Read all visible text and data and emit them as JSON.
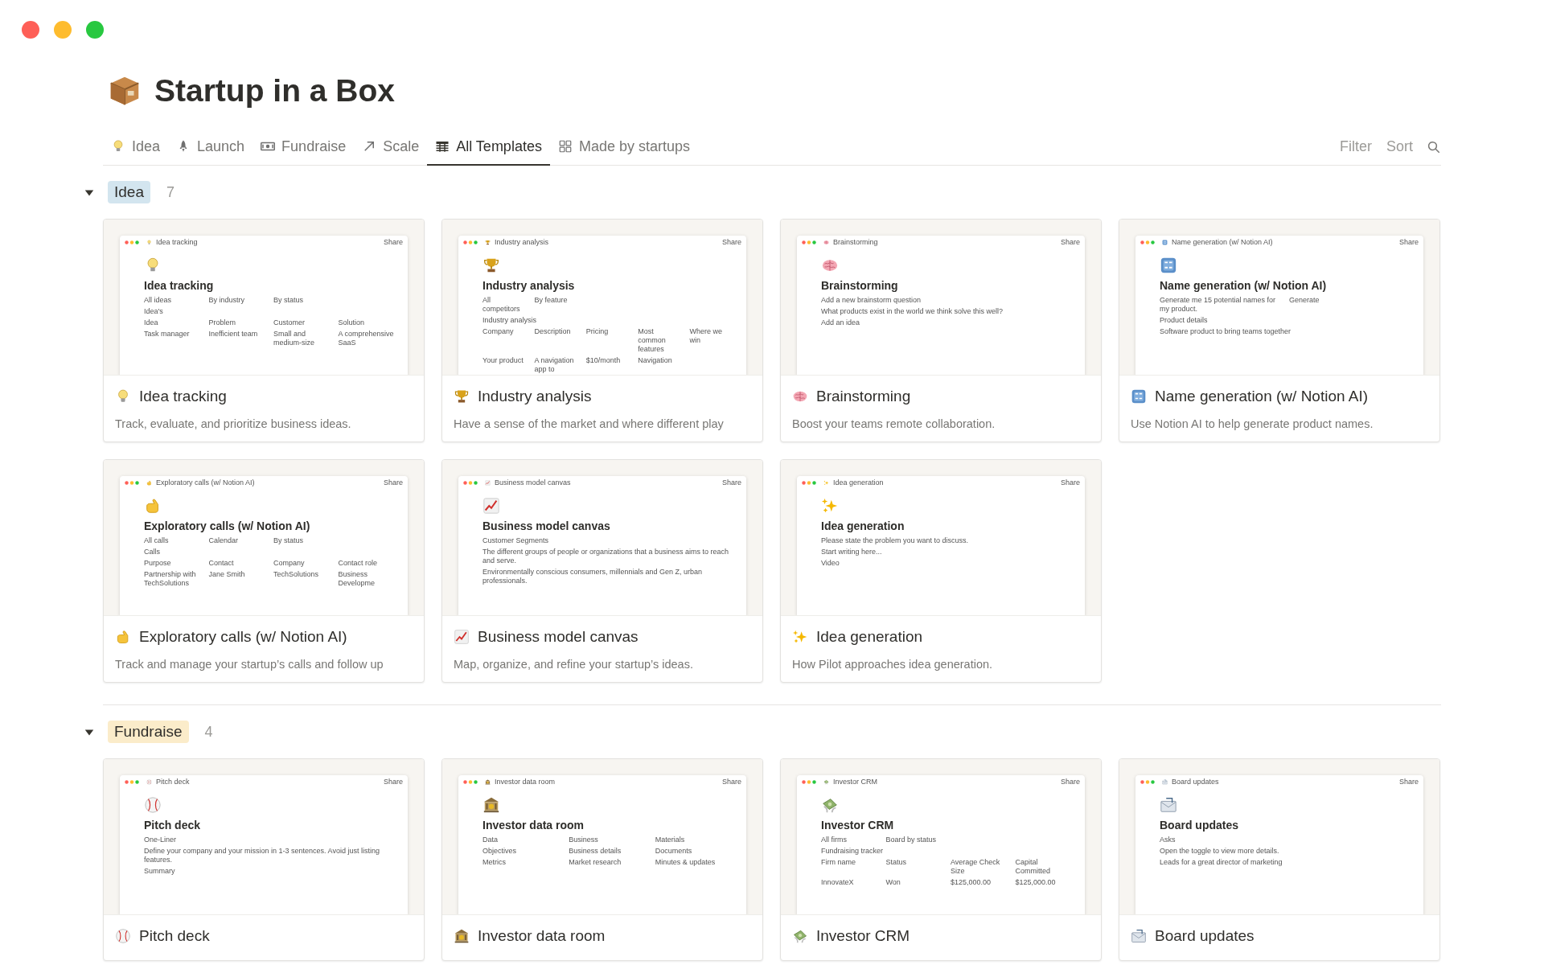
{
  "page": {
    "title": "Startup in a Box"
  },
  "tabs": [
    {
      "label": "Idea",
      "selected": false
    },
    {
      "label": "Launch",
      "selected": false
    },
    {
      "label": "Fundraise",
      "selected": false
    },
    {
      "label": "Scale",
      "selected": false
    },
    {
      "label": "All Templates",
      "selected": true
    },
    {
      "label": "Made by startups",
      "selected": false
    }
  ],
  "view_actions": [
    "Filter",
    "Sort"
  ],
  "groups": [
    {
      "label": "Idea",
      "count": "7",
      "color": "#d3e5ef",
      "expanded": true,
      "cards": [
        {
          "title": "Idea tracking",
          "description": "Track, evaluate, and prioritize business ideas.",
          "preview": {
            "crumb": "Idea tracking",
            "share": "Share",
            "title": "Idea tracking",
            "rows": [
              [
                "All ideas",
                "By industry",
                "By status"
              ],
              [
                "Idea's"
              ],
              [
                "Idea",
                "Problem",
                "Customer",
                "Solution"
              ],
              [
                "Task manager",
                "Inefficient team",
                "Small and medium-size",
                "A comprehensive SaaS"
              ]
            ]
          }
        },
        {
          "title": "Industry analysis",
          "description": "Have a sense of the market and where different play",
          "preview": {
            "crumb": "Industry analysis",
            "share": "Share",
            "title": "Industry analysis",
            "rows": [
              [
                "All competitors",
                "By feature"
              ],
              [
                "Industry analysis"
              ],
              [
                "Company",
                "Description",
                "Pricing",
                "Most common features",
                "Where we win"
              ],
              [
                "Your product",
                "A navigation app to",
                "$10/month",
                "Navigation"
              ]
            ]
          }
        },
        {
          "title": "Brainstorming",
          "description": "Boost your teams remote collaboration.",
          "preview": {
            "crumb": "Brainstorming",
            "share": "Share",
            "title": "Brainstorming",
            "rows": [
              [
                "Add a new brainstorm question"
              ],
              [
                "What products exist in the world we think solve this well?"
              ],
              [
                "Add an idea"
              ]
            ]
          }
        },
        {
          "title": "Name generation (w/ Notion AI)",
          "description": "Use Notion AI to help generate product names.",
          "preview": {
            "crumb": "Name generation (w/ Notion AI)",
            "share": "Share",
            "title": "Name generation (w/ Notion AI)",
            "rows": [
              [
                "Generate me 15 potential names for my product.",
                "Generate"
              ],
              [
                "Product details"
              ],
              [
                "Software product to bring teams together"
              ]
            ]
          }
        },
        {
          "title": "Exploratory calls (w/ Notion AI)",
          "description": "Track and manage your startup’s calls and follow up",
          "preview": {
            "crumb": "Exploratory calls (w/ Notion AI)",
            "share": "Share",
            "title": "Exploratory calls (w/ Notion AI)",
            "rows": [
              [
                "All calls",
                "Calendar",
                "By status"
              ],
              [
                "Calls"
              ],
              [
                "Purpose",
                "Contact",
                "Company",
                "Contact role"
              ],
              [
                "Partnership with TechSolutions",
                "Jane Smith",
                "TechSolutions",
                "Business Developme"
              ]
            ]
          }
        },
        {
          "title": "Business model canvas",
          "description": "Map, organize, and refine your startup’s ideas.",
          "preview": {
            "crumb": "Business model canvas",
            "share": "Share",
            "title": "Business model canvas",
            "rows": [
              [
                "Customer Segments"
              ],
              [
                "The different groups of people or organizations that a business aims to reach and serve."
              ],
              [
                "Environmentally conscious consumers, millennials and Gen Z, urban professionals."
              ]
            ]
          }
        },
        {
          "title": "Idea generation",
          "description": "How Pilot approaches idea generation.",
          "preview": {
            "crumb": "Idea generation",
            "share": "Share",
            "title": "Idea generation",
            "rows": [
              [
                "Please state the problem you want to discuss."
              ],
              [
                "Start writing here..."
              ],
              [
                "Video"
              ]
            ]
          }
        }
      ]
    },
    {
      "label": "Fundraise",
      "count": "4",
      "color": "#fbecca",
      "expanded": true,
      "cards": [
        {
          "title": "Pitch deck",
          "preview": {
            "crumb": "Pitch deck",
            "share": "Share",
            "title": "Pitch deck",
            "rows": [
              [
                "One-Liner"
              ],
              [
                "Define your company and your mission in 1-3 sentences. Avoid just listing features."
              ],
              [
                "Summary"
              ]
            ]
          }
        },
        {
          "title": "Investor data room",
          "preview": {
            "crumb": "Investor data room",
            "share": "Share",
            "title": "Investor data room",
            "rows": [
              [
                "Data",
                "Business",
                "Materials"
              ],
              [
                "Objectives",
                "Business details",
                "Documents"
              ],
              [
                "Metrics",
                "Market research",
                "Minutes & updates"
              ]
            ]
          }
        },
        {
          "title": "Investor CRM",
          "preview": {
            "crumb": "Investor CRM",
            "share": "Share",
            "title": "Investor CRM",
            "rows": [
              [
                "All firms",
                "Board by status"
              ],
              [
                "Fundraising tracker"
              ],
              [
                "Firm name",
                "Status",
                "Average Check Size",
                "Capital Committed"
              ],
              [
                "InnovateX",
                "Won",
                "$125,000.00",
                "$125,000.00"
              ]
            ]
          }
        },
        {
          "title": "Board updates",
          "preview": {
            "crumb": "Board updates",
            "share": "Share",
            "title": "Board updates",
            "rows": [
              [
                "Asks"
              ],
              [
                "Open the toggle to view more details."
              ],
              [
                "Leads for a great director of marketing"
              ]
            ]
          }
        }
      ]
    }
  ]
}
